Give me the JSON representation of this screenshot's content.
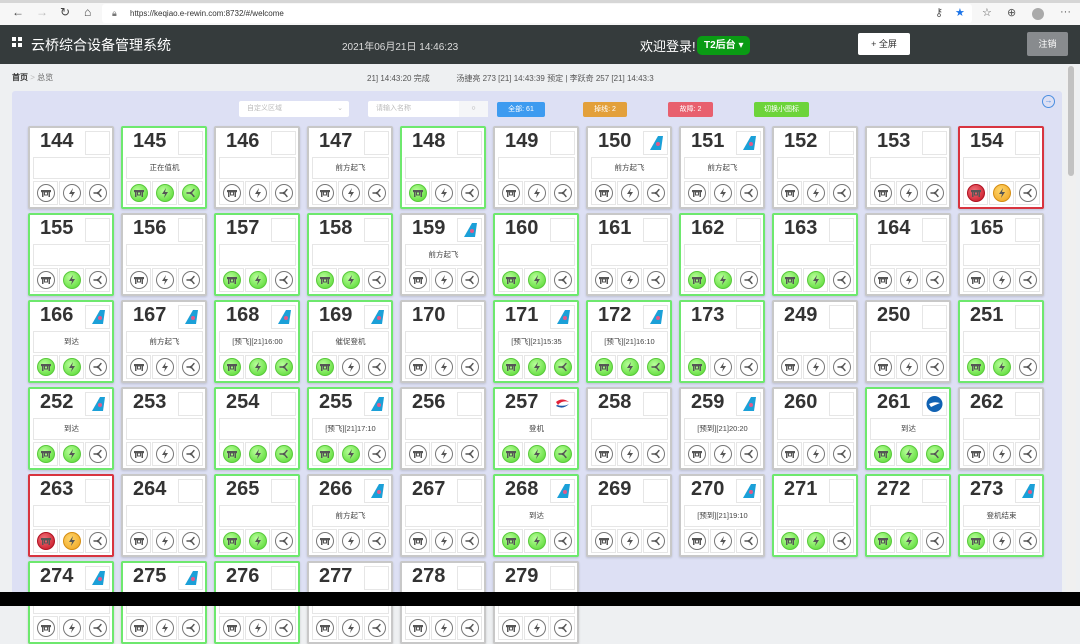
{
  "browser": {
    "url": "https://keqiao.e-rewin.com:8732/#/welcome"
  },
  "header": {
    "title": "云桥综合设备管理系统",
    "datetime": "2021年06月21日 14:46:23",
    "welcome": "欢迎登录!",
    "terminal": "T2后台",
    "fullscreen": "全屏",
    "logout": "注销"
  },
  "breadcrumb": {
    "home": "首页",
    "current": "总览"
  },
  "ticker": "21] 14:43:20 完成            汤捷亮 273 [21] 14:43:39 预定 | 李跃奇 257 [21] 14:43:3",
  "toolbar": {
    "area_placeholder": "自定义区域",
    "search_placeholder": "请输入名称",
    "all": "全部: 61",
    "offline": "掉线: 2",
    "fault": "故障: 2",
    "switch": "切换小图标"
  },
  "colors": {
    "all": "#3d9bf0",
    "offline": "#e3a03a",
    "fault": "#e8606e",
    "switch": "#6dd43a",
    "online": "#6ee86e",
    "error": "#d8343f"
  },
  "cards": [
    {
      "id": "144",
      "border": "none",
      "logo": "",
      "status": "",
      "icons": [
        "n",
        "n",
        "n"
      ]
    },
    {
      "id": "145",
      "border": "green",
      "logo": "",
      "status": "正在值机",
      "icons": [
        "g",
        "g",
        "g"
      ]
    },
    {
      "id": "146",
      "border": "none",
      "logo": "",
      "status": "",
      "icons": [
        "n",
        "n",
        "n"
      ]
    },
    {
      "id": "147",
      "border": "none",
      "logo": "",
      "status": "前方起飞",
      "icons": [
        "n",
        "n",
        "n"
      ]
    },
    {
      "id": "148",
      "border": "green",
      "logo": "",
      "status": "",
      "icons": [
        "g",
        "n",
        "n"
      ]
    },
    {
      "id": "149",
      "border": "none",
      "logo": "",
      "status": "",
      "icons": [
        "n",
        "n",
        "n"
      ]
    },
    {
      "id": "150",
      "border": "none",
      "logo": "csa",
      "status": "前方起飞",
      "icons": [
        "n",
        "n",
        "n"
      ]
    },
    {
      "id": "151",
      "border": "none",
      "logo": "csa",
      "status": "前方起飞",
      "icons": [
        "n",
        "n",
        "n"
      ]
    },
    {
      "id": "152",
      "border": "none",
      "logo": "",
      "status": "",
      "icons": [
        "n",
        "n",
        "n"
      ]
    },
    {
      "id": "153",
      "border": "none",
      "logo": "",
      "status": "",
      "icons": [
        "n",
        "n",
        "n"
      ]
    },
    {
      "id": "154",
      "border": "red",
      "logo": "",
      "status": "",
      "icons": [
        "r",
        "o",
        "n"
      ]
    },
    {
      "id": "155",
      "border": "green",
      "logo": "",
      "status": "",
      "icons": [
        "n",
        "g",
        "n"
      ]
    },
    {
      "id": "156",
      "border": "none",
      "logo": "",
      "status": "",
      "icons": [
        "n",
        "n",
        "n"
      ]
    },
    {
      "id": "157",
      "border": "green",
      "logo": "",
      "status": "",
      "icons": [
        "g",
        "g",
        "n"
      ]
    },
    {
      "id": "158",
      "border": "green",
      "logo": "",
      "status": "",
      "icons": [
        "g",
        "g",
        "n"
      ]
    },
    {
      "id": "159",
      "border": "none",
      "logo": "csa",
      "status": "前方起飞",
      "icons": [
        "n",
        "n",
        "n"
      ]
    },
    {
      "id": "160",
      "border": "green",
      "logo": "",
      "status": "",
      "icons": [
        "g",
        "g",
        "n"
      ]
    },
    {
      "id": "161",
      "border": "none",
      "logo": "",
      "status": "",
      "icons": [
        "n",
        "n",
        "n"
      ]
    },
    {
      "id": "162",
      "border": "green",
      "logo": "",
      "status": "",
      "icons": [
        "g",
        "g",
        "n"
      ]
    },
    {
      "id": "163",
      "border": "green",
      "logo": "",
      "status": "",
      "icons": [
        "g",
        "g",
        "n"
      ]
    },
    {
      "id": "164",
      "border": "none",
      "logo": "",
      "status": "",
      "icons": [
        "n",
        "n",
        "n"
      ]
    },
    {
      "id": "165",
      "border": "none",
      "logo": "",
      "status": "",
      "icons": [
        "n",
        "n",
        "n"
      ]
    },
    {
      "id": "166",
      "border": "green",
      "logo": "csa",
      "status": "到达",
      "icons": [
        "g",
        "g",
        "n"
      ]
    },
    {
      "id": "167",
      "border": "none",
      "logo": "csa",
      "status": "前方起飞",
      "icons": [
        "n",
        "n",
        "n"
      ]
    },
    {
      "id": "168",
      "border": "green",
      "logo": "csa",
      "status": "[预飞][21]16:00",
      "icons": [
        "g",
        "g",
        "g"
      ]
    },
    {
      "id": "169",
      "border": "green",
      "logo": "csa",
      "status": "催促登机",
      "icons": [
        "g",
        "n",
        "n"
      ]
    },
    {
      "id": "170",
      "border": "none",
      "logo": "",
      "status": "",
      "icons": [
        "n",
        "n",
        "n"
      ]
    },
    {
      "id": "171",
      "border": "green",
      "logo": "csa",
      "status": "[预飞][21]15:35",
      "icons": [
        "g",
        "g",
        "g"
      ]
    },
    {
      "id": "172",
      "border": "green",
      "logo": "csa",
      "status": "[预飞][21]16:10",
      "icons": [
        "g",
        "g",
        "g"
      ]
    },
    {
      "id": "173",
      "border": "green",
      "logo": "",
      "status": "",
      "icons": [
        "g",
        "n",
        "n"
      ]
    },
    {
      "id": "249",
      "border": "none",
      "logo": "",
      "status": "",
      "icons": [
        "n",
        "n",
        "n"
      ]
    },
    {
      "id": "250",
      "border": "none",
      "logo": "",
      "status": "",
      "icons": [
        "n",
        "n",
        "n"
      ]
    },
    {
      "id": "251",
      "border": "green",
      "logo": "",
      "status": "",
      "icons": [
        "g",
        "g",
        "n"
      ]
    },
    {
      "id": "252",
      "border": "green",
      "logo": "csa",
      "status": "到达",
      "icons": [
        "g",
        "g",
        "n"
      ]
    },
    {
      "id": "253",
      "border": "none",
      "logo": "",
      "status": "",
      "icons": [
        "n",
        "n",
        "n"
      ]
    },
    {
      "id": "254",
      "border": "green",
      "logo": "",
      "status": "",
      "icons": [
        "g",
        "g",
        "g"
      ]
    },
    {
      "id": "255",
      "border": "green",
      "logo": "csa",
      "status": "[预飞][21]17:10",
      "icons": [
        "g",
        "g",
        "n"
      ]
    },
    {
      "id": "256",
      "border": "none",
      "logo": "",
      "status": "",
      "icons": [
        "n",
        "n",
        "n"
      ]
    },
    {
      "id": "257",
      "border": "green",
      "logo": "kal",
      "status": "登机",
      "icons": [
        "g",
        "g",
        "g"
      ]
    },
    {
      "id": "258",
      "border": "none",
      "logo": "",
      "status": "",
      "icons": [
        "n",
        "n",
        "n"
      ]
    },
    {
      "id": "259",
      "border": "none",
      "logo": "csa",
      "status": "[预到][21]20:20",
      "icons": [
        "n",
        "n",
        "n"
      ]
    },
    {
      "id": "260",
      "border": "none",
      "logo": "",
      "status": "",
      "icons": [
        "n",
        "n",
        "n"
      ]
    },
    {
      "id": "261",
      "border": "green",
      "logo": "blue",
      "status": "到达",
      "icons": [
        "g",
        "g",
        "g"
      ]
    },
    {
      "id": "262",
      "border": "none",
      "logo": "",
      "status": "",
      "icons": [
        "n",
        "n",
        "n"
      ]
    },
    {
      "id": "263",
      "border": "red",
      "logo": "",
      "status": "",
      "icons": [
        "r",
        "o",
        "n"
      ]
    },
    {
      "id": "264",
      "border": "none",
      "logo": "",
      "status": "",
      "icons": [
        "n",
        "n",
        "n"
      ]
    },
    {
      "id": "265",
      "border": "green",
      "logo": "",
      "status": "",
      "icons": [
        "g",
        "g",
        "n"
      ]
    },
    {
      "id": "266",
      "border": "none",
      "logo": "csa",
      "status": "前方起飞",
      "icons": [
        "n",
        "n",
        "n"
      ]
    },
    {
      "id": "267",
      "border": "none",
      "logo": "",
      "status": "",
      "icons": [
        "n",
        "n",
        "n"
      ]
    },
    {
      "id": "268",
      "border": "green",
      "logo": "csa",
      "status": "到达",
      "icons": [
        "g",
        "g",
        "n"
      ]
    },
    {
      "id": "269",
      "border": "none",
      "logo": "",
      "status": "",
      "icons": [
        "n",
        "n",
        "n"
      ]
    },
    {
      "id": "270",
      "border": "none",
      "logo": "csa",
      "status": "[预到][21]19:10",
      "icons": [
        "n",
        "n",
        "n"
      ]
    },
    {
      "id": "271",
      "border": "green",
      "logo": "",
      "status": "",
      "icons": [
        "g",
        "g",
        "n"
      ]
    },
    {
      "id": "272",
      "border": "green",
      "logo": "",
      "status": "",
      "icons": [
        "g",
        "g",
        "n"
      ]
    },
    {
      "id": "273",
      "border": "green",
      "logo": "csa",
      "status": "登机结束",
      "icons": [
        "g",
        "n",
        "n"
      ]
    },
    {
      "id": "274",
      "border": "green",
      "logo": "csa",
      "status": "",
      "icons": [
        "n",
        "n",
        "n"
      ]
    },
    {
      "id": "275",
      "border": "green",
      "logo": "csa",
      "status": "",
      "icons": [
        "n",
        "n",
        "n"
      ]
    },
    {
      "id": "276",
      "border": "green",
      "logo": "",
      "status": "",
      "icons": [
        "n",
        "n",
        "n"
      ]
    },
    {
      "id": "277",
      "border": "none",
      "logo": "",
      "status": "",
      "icons": [
        "n",
        "n",
        "n"
      ]
    },
    {
      "id": "278",
      "border": "none",
      "logo": "",
      "status": "",
      "icons": [
        "n",
        "n",
        "n"
      ]
    },
    {
      "id": "279",
      "border": "none",
      "logo": "",
      "status": "",
      "icons": [
        "n",
        "n",
        "n"
      ]
    }
  ]
}
